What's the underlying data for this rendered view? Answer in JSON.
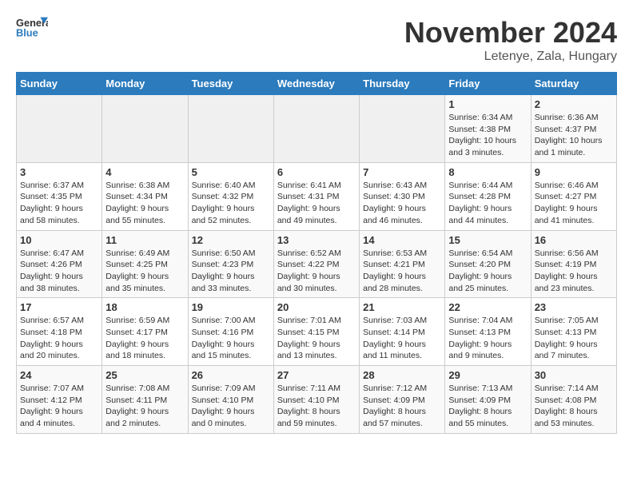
{
  "header": {
    "logo_general": "General",
    "logo_blue": "Blue",
    "month_title": "November 2024",
    "location": "Letenye, Zala, Hungary"
  },
  "weekdays": [
    "Sunday",
    "Monday",
    "Tuesday",
    "Wednesday",
    "Thursday",
    "Friday",
    "Saturday"
  ],
  "weeks": [
    [
      {
        "day": "",
        "info": ""
      },
      {
        "day": "",
        "info": ""
      },
      {
        "day": "",
        "info": ""
      },
      {
        "day": "",
        "info": ""
      },
      {
        "day": "",
        "info": ""
      },
      {
        "day": "1",
        "info": "Sunrise: 6:34 AM\nSunset: 4:38 PM\nDaylight: 10 hours\nand 3 minutes."
      },
      {
        "day": "2",
        "info": "Sunrise: 6:36 AM\nSunset: 4:37 PM\nDaylight: 10 hours\nand 1 minute."
      }
    ],
    [
      {
        "day": "3",
        "info": "Sunrise: 6:37 AM\nSunset: 4:35 PM\nDaylight: 9 hours\nand 58 minutes."
      },
      {
        "day": "4",
        "info": "Sunrise: 6:38 AM\nSunset: 4:34 PM\nDaylight: 9 hours\nand 55 minutes."
      },
      {
        "day": "5",
        "info": "Sunrise: 6:40 AM\nSunset: 4:32 PM\nDaylight: 9 hours\nand 52 minutes."
      },
      {
        "day": "6",
        "info": "Sunrise: 6:41 AM\nSunset: 4:31 PM\nDaylight: 9 hours\nand 49 minutes."
      },
      {
        "day": "7",
        "info": "Sunrise: 6:43 AM\nSunset: 4:30 PM\nDaylight: 9 hours\nand 46 minutes."
      },
      {
        "day": "8",
        "info": "Sunrise: 6:44 AM\nSunset: 4:28 PM\nDaylight: 9 hours\nand 44 minutes."
      },
      {
        "day": "9",
        "info": "Sunrise: 6:46 AM\nSunset: 4:27 PM\nDaylight: 9 hours\nand 41 minutes."
      }
    ],
    [
      {
        "day": "10",
        "info": "Sunrise: 6:47 AM\nSunset: 4:26 PM\nDaylight: 9 hours\nand 38 minutes."
      },
      {
        "day": "11",
        "info": "Sunrise: 6:49 AM\nSunset: 4:25 PM\nDaylight: 9 hours\nand 35 minutes."
      },
      {
        "day": "12",
        "info": "Sunrise: 6:50 AM\nSunset: 4:23 PM\nDaylight: 9 hours\nand 33 minutes."
      },
      {
        "day": "13",
        "info": "Sunrise: 6:52 AM\nSunset: 4:22 PM\nDaylight: 9 hours\nand 30 minutes."
      },
      {
        "day": "14",
        "info": "Sunrise: 6:53 AM\nSunset: 4:21 PM\nDaylight: 9 hours\nand 28 minutes."
      },
      {
        "day": "15",
        "info": "Sunrise: 6:54 AM\nSunset: 4:20 PM\nDaylight: 9 hours\nand 25 minutes."
      },
      {
        "day": "16",
        "info": "Sunrise: 6:56 AM\nSunset: 4:19 PM\nDaylight: 9 hours\nand 23 minutes."
      }
    ],
    [
      {
        "day": "17",
        "info": "Sunrise: 6:57 AM\nSunset: 4:18 PM\nDaylight: 9 hours\nand 20 minutes."
      },
      {
        "day": "18",
        "info": "Sunrise: 6:59 AM\nSunset: 4:17 PM\nDaylight: 9 hours\nand 18 minutes."
      },
      {
        "day": "19",
        "info": "Sunrise: 7:00 AM\nSunset: 4:16 PM\nDaylight: 9 hours\nand 15 minutes."
      },
      {
        "day": "20",
        "info": "Sunrise: 7:01 AM\nSunset: 4:15 PM\nDaylight: 9 hours\nand 13 minutes."
      },
      {
        "day": "21",
        "info": "Sunrise: 7:03 AM\nSunset: 4:14 PM\nDaylight: 9 hours\nand 11 minutes."
      },
      {
        "day": "22",
        "info": "Sunrise: 7:04 AM\nSunset: 4:13 PM\nDaylight: 9 hours\nand 9 minutes."
      },
      {
        "day": "23",
        "info": "Sunrise: 7:05 AM\nSunset: 4:13 PM\nDaylight: 9 hours\nand 7 minutes."
      }
    ],
    [
      {
        "day": "24",
        "info": "Sunrise: 7:07 AM\nSunset: 4:12 PM\nDaylight: 9 hours\nand 4 minutes."
      },
      {
        "day": "25",
        "info": "Sunrise: 7:08 AM\nSunset: 4:11 PM\nDaylight: 9 hours\nand 2 minutes."
      },
      {
        "day": "26",
        "info": "Sunrise: 7:09 AM\nSunset: 4:10 PM\nDaylight: 9 hours\nand 0 minutes."
      },
      {
        "day": "27",
        "info": "Sunrise: 7:11 AM\nSunset: 4:10 PM\nDaylight: 8 hours\nand 59 minutes."
      },
      {
        "day": "28",
        "info": "Sunrise: 7:12 AM\nSunset: 4:09 PM\nDaylight: 8 hours\nand 57 minutes."
      },
      {
        "day": "29",
        "info": "Sunrise: 7:13 AM\nSunset: 4:09 PM\nDaylight: 8 hours\nand 55 minutes."
      },
      {
        "day": "30",
        "info": "Sunrise: 7:14 AM\nSunset: 4:08 PM\nDaylight: 8 hours\nand 53 minutes."
      }
    ]
  ]
}
